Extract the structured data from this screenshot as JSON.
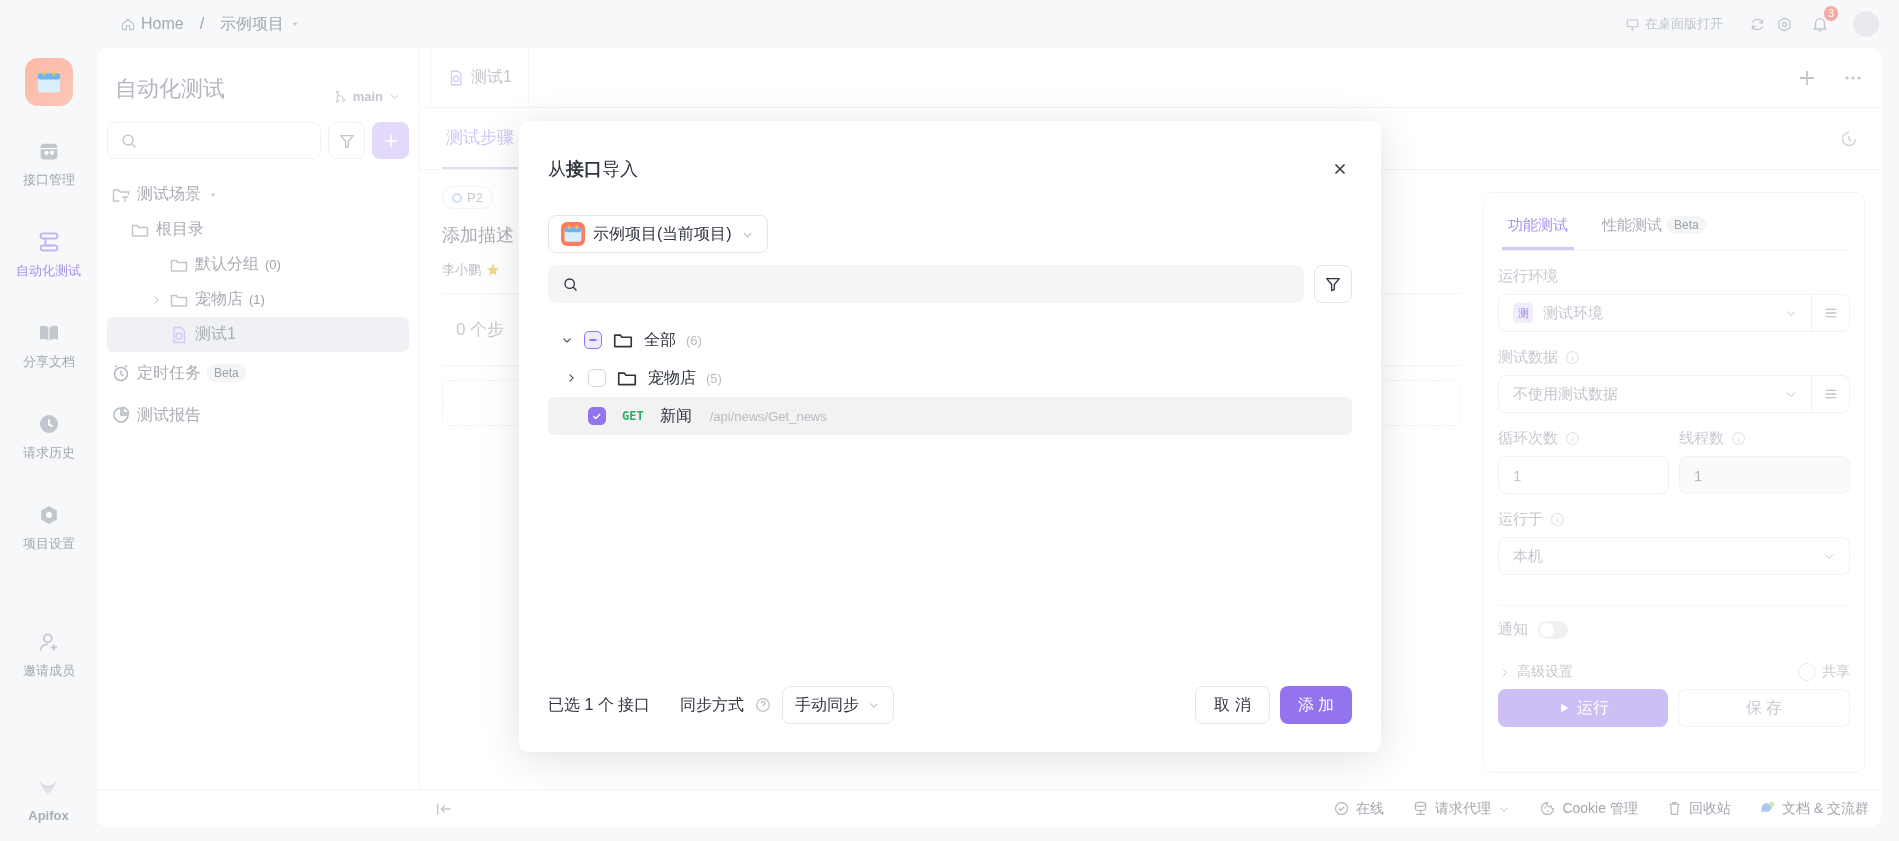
{
  "topbar": {
    "breadcrumb": [
      {
        "kind": "home",
        "label": "Home"
      },
      {
        "kind": "project",
        "label": "示例项目"
      }
    ],
    "separator": "/",
    "open_desktop": "在桌面版打开",
    "notifications": "3"
  },
  "nav": {
    "items": [
      {
        "kind": "api",
        "label": "接口管理",
        "selected": false
      },
      {
        "kind": "auto",
        "label": "自动化测试",
        "selected": true
      },
      {
        "kind": "book",
        "label": "分享文档",
        "selected": false
      },
      {
        "kind": "history",
        "label": "请求历史",
        "selected": false
      },
      {
        "kind": "settings",
        "label": "项目设置",
        "selected": false
      },
      {
        "kind": "invite",
        "label": "邀请成员",
        "selected": false
      }
    ],
    "brand": "Apifox"
  },
  "tree_panel": {
    "title": "自动化测试",
    "branch": "main",
    "tree": [
      {
        "kind": "scenes",
        "label": "测试场景",
        "selected": false,
        "children": [
          {
            "kind": "folder",
            "label": "根目录",
            "selected": false,
            "children": [
              {
                "kind": "folder",
                "label": "默认分组",
                "count": "(0)",
                "selected": false
              },
              {
                "kind": "folder",
                "label": "宠物店",
                "count": "(1)",
                "expanded": false,
                "selected": false
              },
              {
                "kind": "case",
                "label": "测试1",
                "selected": true
              }
            ]
          }
        ]
      }
    ],
    "extras": [
      {
        "kind": "clock",
        "label": "定时任务",
        "badge": "Beta"
      },
      {
        "kind": "report",
        "label": "测试报告"
      }
    ]
  },
  "main": {
    "doc_tab": "测试1",
    "tabs": [
      {
        "label": "测试步骤",
        "selected": true
      }
    ],
    "priority": "P2",
    "description_placeholder": "添加描述",
    "author": "李小鹏",
    "steps_count": "0 个步"
  },
  "run_panel": {
    "tabs": [
      {
        "label": "功能测试",
        "selected": true
      },
      {
        "label": "性能测试",
        "badge": "Beta",
        "selected": false
      }
    ],
    "environment": {
      "label": "运行环境",
      "tag": "测",
      "value": "测试环境"
    },
    "test_data": {
      "label": "测试数据",
      "value": "不使用测试数据"
    },
    "loops": {
      "label": "循环次数",
      "value": "1"
    },
    "threads": {
      "label": "线程数",
      "value": "1",
      "disabled": true
    },
    "run_on": {
      "label": "运行于",
      "value": "本机"
    },
    "notify": {
      "label": "通知",
      "on": false
    },
    "advanced": "高级设置",
    "share": {
      "label": "共享",
      "on": false
    },
    "run": "运行",
    "save": "保 存"
  },
  "status_bar": {
    "items": [
      {
        "kind": "check",
        "label": "在线",
        "dropdown": false
      },
      {
        "kind": "proxy",
        "label": "请求代理",
        "dropdown": true
      },
      {
        "kind": "cookie",
        "label": "Cookie 管理",
        "dropdown": false
      },
      {
        "kind": "trash",
        "label": "回收站",
        "dropdown": false
      },
      {
        "kind": "chat",
        "label": "文档 & 交流群",
        "dropdown": false
      }
    ]
  },
  "dialog": {
    "title": "从**接口**导入",
    "project": "示例项目(当前项目)",
    "tree": [
      {
        "kind": "folder",
        "label": "全部",
        "count": "(6)",
        "expanded": true,
        "checked": false,
        "indeterminate": true,
        "selected": false,
        "children": [
          {
            "kind": "folder",
            "label": "宠物店",
            "count": "(5)",
            "expanded": false,
            "checked": false,
            "selected": false
          },
          {
            "kind": "endpoint",
            "method": "GET",
            "label": "新闻",
            "path": "/api/news/Get_news",
            "checked": true,
            "selected": true
          }
        ]
      }
    ],
    "selected_summary": "已选 1 个 接口",
    "sync_label": "同步方式",
    "sync_value": "手动同步",
    "cancel": "取 消",
    "confirm": "添 加"
  }
}
